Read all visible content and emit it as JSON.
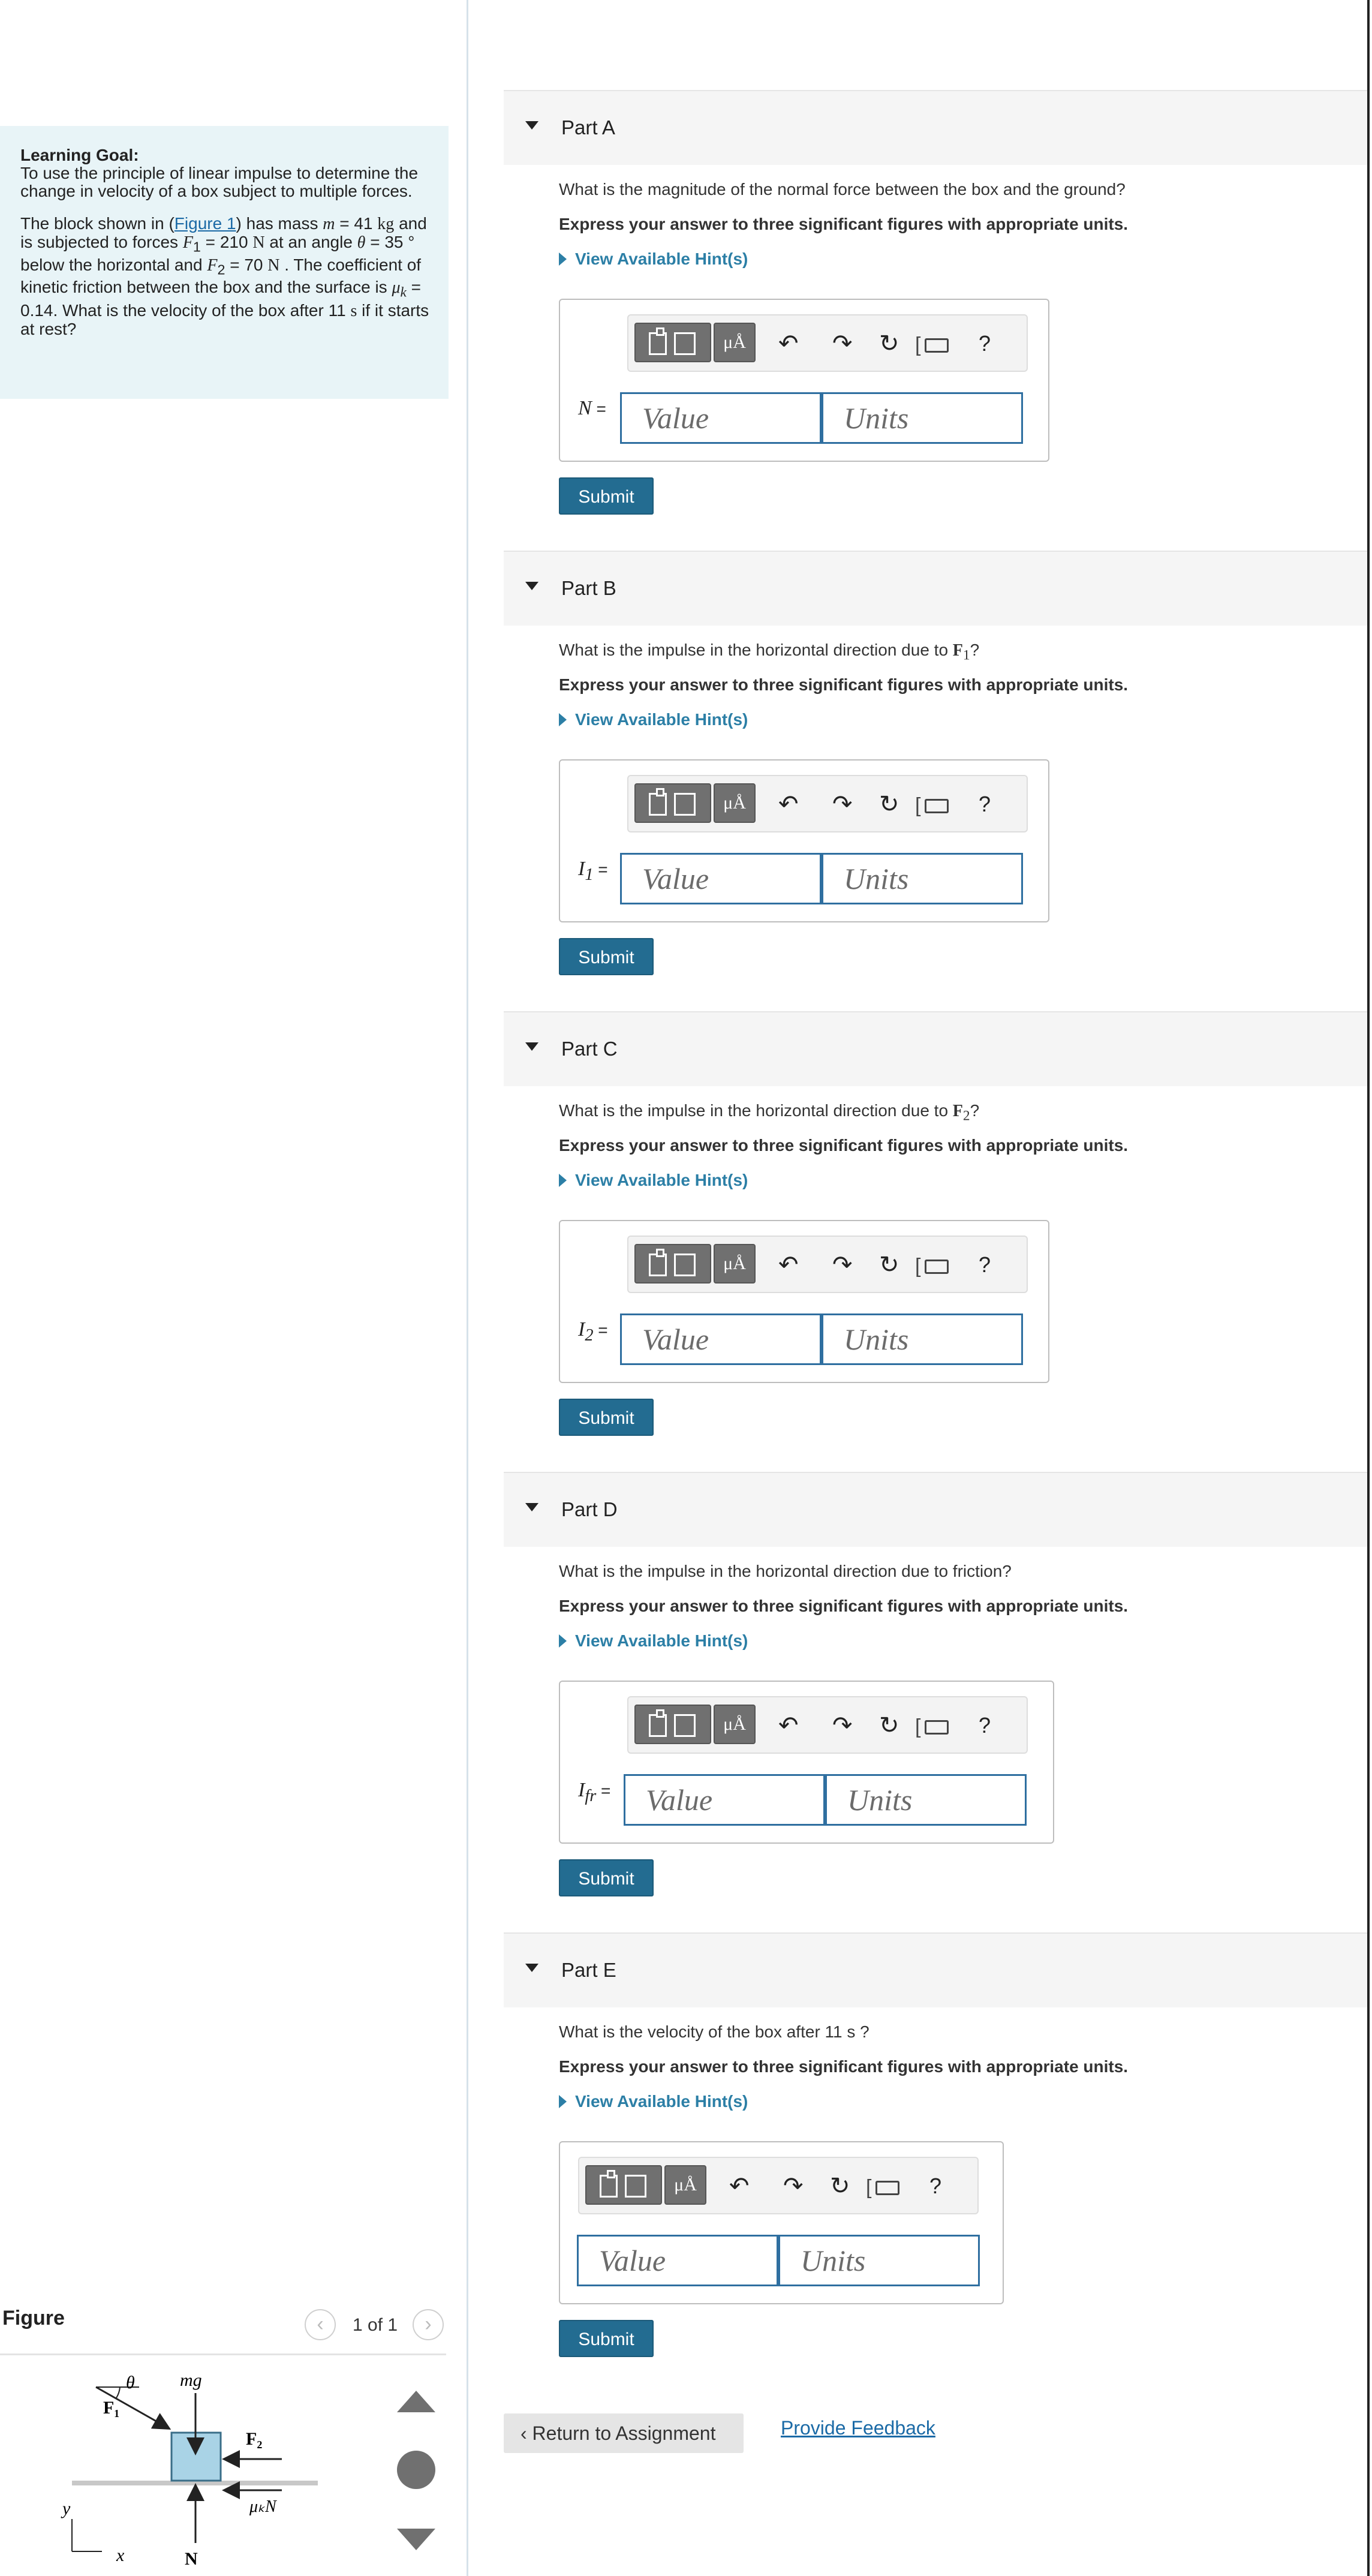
{
  "learning_goal": {
    "heading": "Learning Goal:",
    "text": "To use the principle of linear impulse to determine the change in velocity of a box subject to multiple forces.",
    "problem": {
      "pre": "The block shown in (",
      "figure_link": "Figure 1",
      "s1": ") has mass ",
      "m_sym": "m",
      "m_val": " = 41 ",
      "m_unit": "kg",
      "s2": " and is subjected to forces ",
      "f1_sym": "F",
      "f1_sub": "1",
      "f1_val": " = 210 ",
      "f1_unit": "N",
      "s3": " at an angle ",
      "theta_sym": "θ",
      "theta_val": " = 35 ° below the horizontal and ",
      "f2_sym": "F",
      "f2_sub": "2",
      "f2_val": " = 70 ",
      "f2_unit": "N",
      "s4": " . The coefficient of kinetic friction between the box and the surface is ",
      "mu_sym": "μ",
      "mu_sub": "k",
      "mu_val": " = 0.14. What is the velocity of the box after 11 ",
      "s_unit": "s",
      "end": " if it starts at rest?"
    }
  },
  "parts": [
    {
      "label": "Part A",
      "question": "What is the magnitude of the normal force between the box and the ground?",
      "var": "N",
      "var_sub": ""
    },
    {
      "label": "Part B",
      "question_pre": "What is the impulse in the horizontal direction due to ",
      "question_sym": "F",
      "question_sub": "1",
      "question_end": "?",
      "var": "I",
      "var_sub": "1"
    },
    {
      "label": "Part C",
      "question_pre": "What is the impulse in the horizontal direction due to ",
      "question_sym": "F",
      "question_sub": "2",
      "question_end": "?",
      "var": "I",
      "var_sub": "2"
    },
    {
      "label": "Part D",
      "question": "What is the impulse in the horizontal direction due to friction?",
      "var": "I",
      "var_sub": "fr"
    },
    {
      "label": "Part E",
      "question": "What is the velocity of the box after 11 s ?",
      "var": "",
      "var_sub": ""
    }
  ],
  "common": {
    "express": "Express your answer to three significant figures with appropriate units.",
    "hint": "View Available Hint(s)",
    "value_placeholder": "Value",
    "units_placeholder": "Units",
    "equals": " =",
    "submit": "Submit",
    "mu_button": "μÅ",
    "help": "?"
  },
  "figure": {
    "title": "Figure",
    "pager": "1 of 1",
    "labels": {
      "theta": "θ",
      "mg": "mg",
      "F1": "F₁",
      "F2": "F₂",
      "muN": "μₖN",
      "N": "N",
      "y": "y",
      "x": "x"
    },
    "colors": {
      "box": "#a9d3e6",
      "box_border": "#3a6e88",
      "ground": "#c8c8c8"
    }
  },
  "footer": {
    "return": "Return to Assignment",
    "feedback": "Provide Feedback"
  },
  "colors": {
    "accent": "#236c91",
    "link": "#1b6aa6",
    "goal_bg": "#e8f4f7"
  }
}
